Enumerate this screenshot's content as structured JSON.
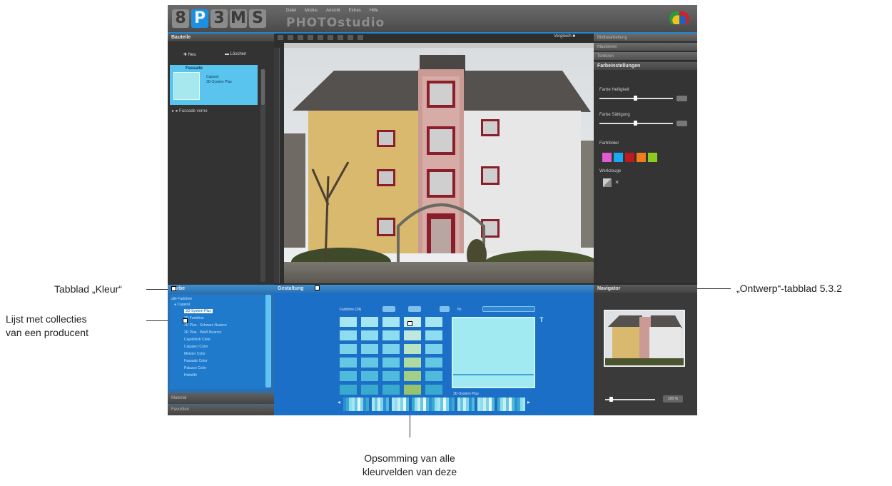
{
  "annotations": {
    "tab_color": "Tabblad „Kleur“",
    "collections_line1": "Lijst met collecties",
    "collections_line2": "van een producent",
    "design_tab": "„Ontwerp“-tabblad 5.3.2",
    "fields_line1": "Opsomming van alle",
    "fields_line2": "kleurvelden van deze"
  },
  "app": {
    "logo_letters": [
      "8",
      "P",
      "3",
      "M",
      "S"
    ],
    "title": "PHOTOstudio",
    "menu": [
      "Datei",
      "Modus",
      "Ansicht",
      "Extras",
      "Hilfe"
    ]
  },
  "left_panel": {
    "header": "Bauteile",
    "new_label": "Neu",
    "delete_label": "Löschen",
    "project_title": "Fassade",
    "project_info": [
      "Caparol",
      "3D-System Plus"
    ],
    "other_item": "Fassade vorne"
  },
  "main": {
    "compare_label": "Vergleich"
  },
  "right_panel": {
    "tabs": [
      "Bildbearbeitung",
      "Maskieren",
      "Texturen"
    ],
    "section": "Farbeinstellungen",
    "slider1_label": "Farbe Helligkeit",
    "slider2_label": "Farbe Sättigung",
    "colors_label": "Farbfelder",
    "swatch_colors": [
      "#e05bd0",
      "#19a9f0",
      "#c0181f",
      "#f07c1c",
      "#8ccc1f"
    ],
    "tools_label": "Werkzeuge"
  },
  "bottom_left": {
    "header": "Farbe",
    "brand": "Caparol",
    "root": "alle Farbtöne",
    "items": [
      "3D-System Plus",
      "3D Farbtöne",
      "3D Plus - Schwarz Nuance",
      "3D Plus - Weiß Nuance",
      "Capafinish Color",
      "Capatect Color",
      "Meister Color",
      "Fassade Color",
      "Palazzo Color",
      "Histolith"
    ],
    "tab2": "Material",
    "tab3": "Favoriten"
  },
  "bottom_mid": {
    "header": "Gestaltung",
    "subtitle": "Farbtöne (24)",
    "search_label": "Nr.",
    "code": "3D-System Plus"
  },
  "bottom_right": {
    "header": "Navigator",
    "zoom": "100 %"
  }
}
